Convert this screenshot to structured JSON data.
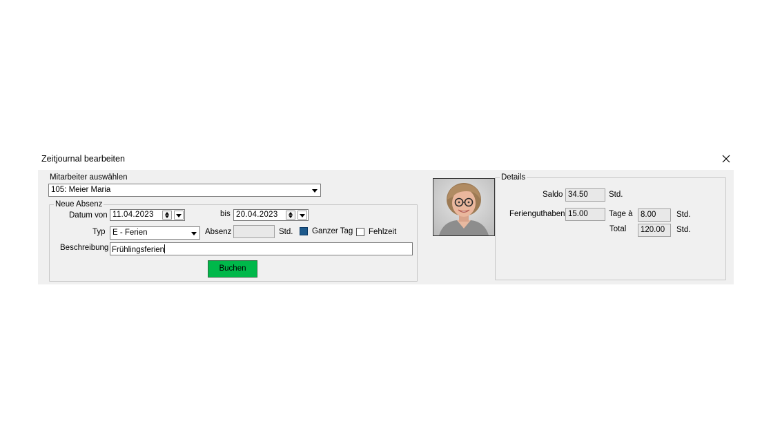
{
  "window": {
    "title": "Zeitjournal bearbeiten",
    "close_icon": "close-icon"
  },
  "employee": {
    "label": "Mitarbeiter auswählen",
    "selected": "105: Meier Maria"
  },
  "absence": {
    "legend": "Neue Absenz",
    "date_from_label": "Datum von",
    "date_from": "11.04.2023",
    "date_to_label": "bis",
    "date_to": "20.04.2023",
    "type_label": "Typ",
    "type_value": "E - Ferien",
    "absenz_label": "Absenz",
    "absenz_value": "",
    "absenz_unit": "Std.",
    "full_day_label": "Ganzer Tag",
    "full_day_checked": true,
    "fehlzeit_label": "Fehlzeit",
    "fehlzeit_checked": false,
    "description_label": "Beschreibung",
    "description_value": "Frühlingsferien",
    "book_button": "Buchen",
    "book_button_color": "#00b84a"
  },
  "details": {
    "legend": "Details",
    "saldo_label": "Saldo",
    "saldo_value": "34.50",
    "saldo_unit": "Std.",
    "ferienguthaben_label": "Ferienguthaben",
    "ferienguthaben_value": "15.00",
    "tage_label": "Tage à",
    "tage_value": "8.00",
    "tage_unit": "Std.",
    "total_label": "Total",
    "total_value": "120.00",
    "total_unit": "Std."
  }
}
